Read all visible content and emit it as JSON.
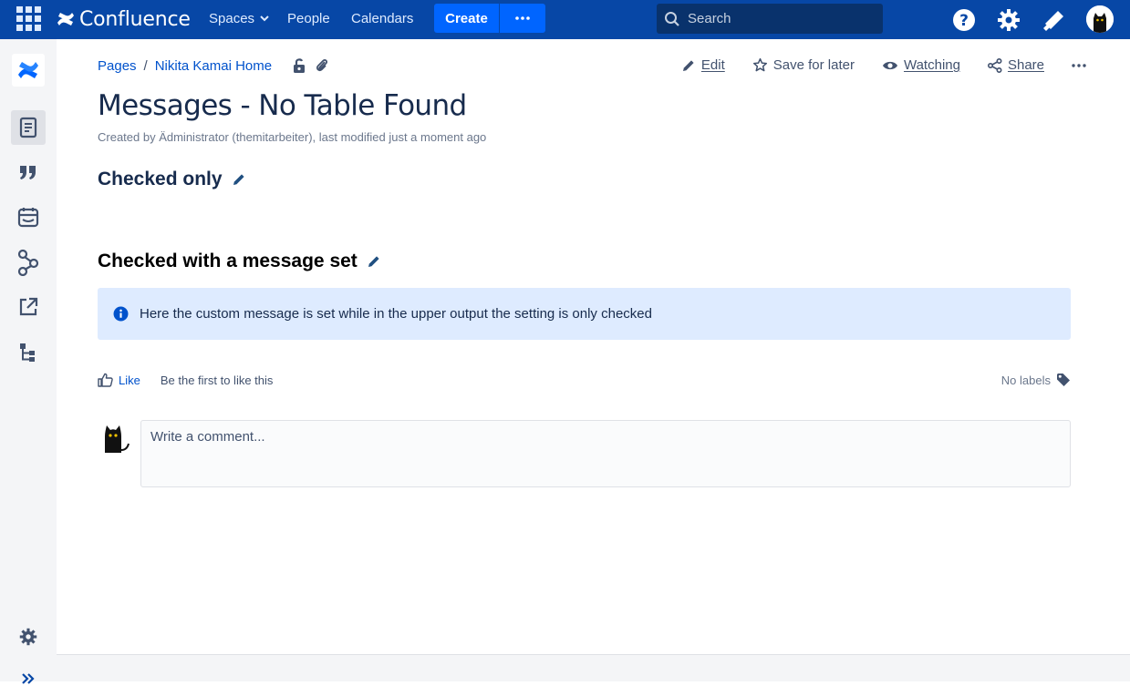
{
  "topbar": {
    "logo_text": "Confluence",
    "nav": {
      "spaces": "Spaces",
      "people": "People",
      "calendars": "Calendars"
    },
    "create_label": "Create",
    "search_placeholder": "Search"
  },
  "breadcrumb": {
    "pages": "Pages",
    "separator": "/",
    "home": "Nikita Kamai Home"
  },
  "actions": {
    "edit": "Edit",
    "save_for_later": "Save for later",
    "watching": "Watching",
    "share": "Share"
  },
  "page": {
    "title": "Messages - No Table Found",
    "byline": "Created by Ädministrator (themitarbeiter), last modified just a moment ago",
    "heading_checked": "Checked only",
    "heading_message": "Checked with a message set",
    "info_text": "Here the custom message is set while in the upper output the setting is only checked"
  },
  "like_row": {
    "like": "Like",
    "first_to_like": "Be the first to like this",
    "no_labels": "No labels"
  },
  "comment": {
    "placeholder": "Write a comment..."
  },
  "colors": {
    "nav_bg": "#0747a6",
    "create_bg": "#0065ff",
    "link": "#0052cc",
    "info_bg": "#deebff"
  }
}
